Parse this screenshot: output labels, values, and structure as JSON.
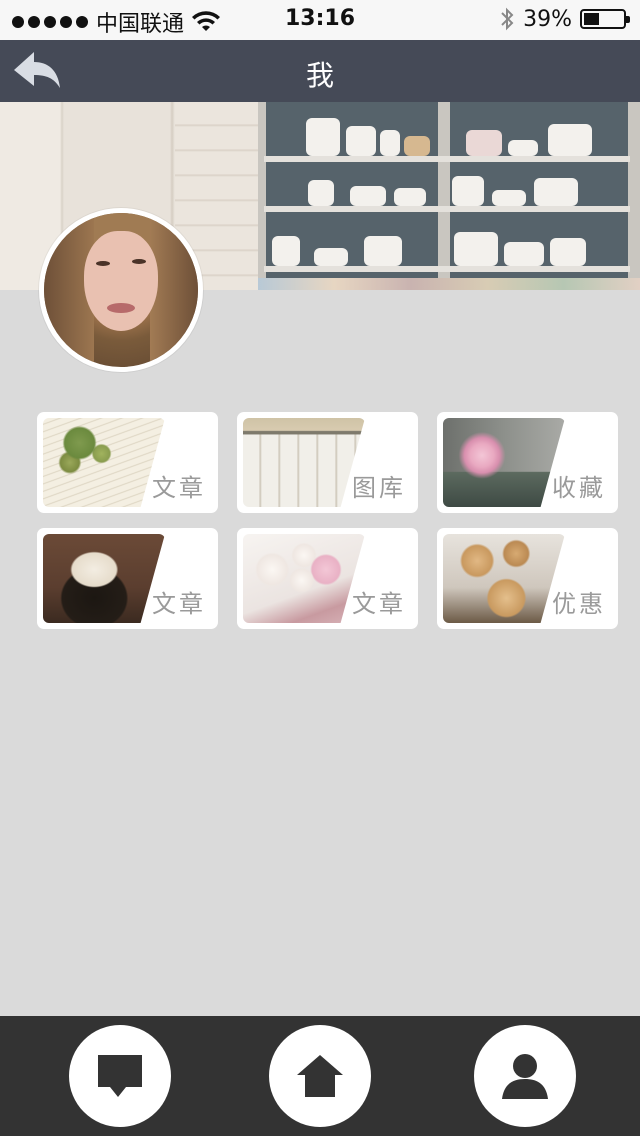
{
  "status_bar": {
    "carrier": "中国联通",
    "time": "13:16",
    "battery_percent": "39%",
    "battery_level": 0.39
  },
  "nav": {
    "title": "我",
    "back_icon": "back-arrow-icon"
  },
  "tiles": [
    {
      "label": "文章",
      "image": "open-book-with-succulent"
    },
    {
      "label": "图库",
      "image": "dining-table-chairs"
    },
    {
      "label": "收藏",
      "image": "pink-flower-in-bottle"
    },
    {
      "label": "文章",
      "image": "tea-cup-on-saucer"
    },
    {
      "label": "文章",
      "image": "macarons-on-tray"
    },
    {
      "label": "优惠",
      "image": "wooden-spheres"
    }
  ],
  "tab_bar": {
    "items": [
      {
        "icon": "message-icon"
      },
      {
        "icon": "home-icon"
      },
      {
        "icon": "user-icon"
      }
    ]
  }
}
